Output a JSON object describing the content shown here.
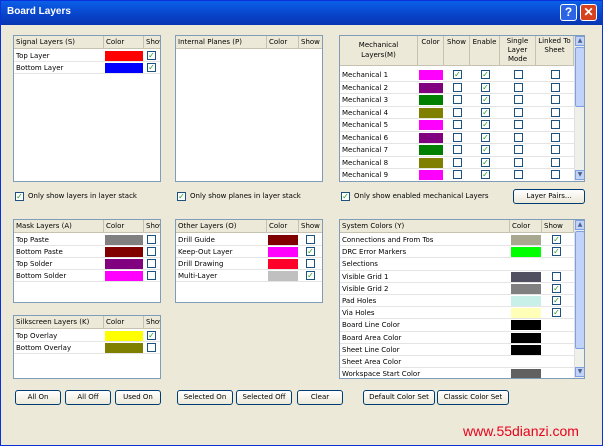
{
  "window": {
    "title": "Board Layers",
    "help_label": "?",
    "close_label": "✕"
  },
  "signal": {
    "headers": {
      "name": "Signal Layers (S)",
      "color": "Color",
      "show": "Show"
    },
    "rows": [
      {
        "name": "Top Layer",
        "color": "#ff0000",
        "show": true
      },
      {
        "name": "Bottom Layer",
        "color": "#0000ff",
        "show": true
      }
    ],
    "option": "Only show layers in layer stack"
  },
  "planes": {
    "headers": {
      "name": "Internal Planes (P)",
      "color": "Color",
      "show": "Show"
    },
    "option": "Only show planes in layer stack"
  },
  "mech": {
    "headers": {
      "name": "Mechanical Layers(M)",
      "color": "Color",
      "show": "Show",
      "enable": "Enable",
      "single": "Single Layer Mode",
      "linked": "Linked To Sheet"
    },
    "rows": [
      {
        "name": "Mechanical 1",
        "color": "#ff00ff",
        "show": true,
        "enable": true
      },
      {
        "name": "Mechanical 2",
        "color": "#800080",
        "show": false,
        "enable": true
      },
      {
        "name": "Mechanical 3",
        "color": "#008000",
        "show": false,
        "enable": true
      },
      {
        "name": "Mechanical 4",
        "color": "#808000",
        "show": false,
        "enable": true
      },
      {
        "name": "Mechanical 5",
        "color": "#ff00ff",
        "show": false,
        "enable": true
      },
      {
        "name": "Mechanical 6",
        "color": "#800080",
        "show": false,
        "enable": true
      },
      {
        "name": "Mechanical 7",
        "color": "#008000",
        "show": false,
        "enable": true
      },
      {
        "name": "Mechanical 8",
        "color": "#808000",
        "show": false,
        "enable": true
      },
      {
        "name": "Mechanical 9",
        "color": "#ff00ff",
        "show": false,
        "enable": true
      }
    ],
    "option": "Only show enabled mechanical Layers",
    "layer_pairs": "Layer Pairs..."
  },
  "mask": {
    "headers": {
      "name": "Mask Layers (A)",
      "color": "Color",
      "show": "Show"
    },
    "rows": [
      {
        "name": "Top Paste",
        "color": "#808080",
        "show": false
      },
      {
        "name": "Bottom Paste",
        "color": "#800000",
        "show": false
      },
      {
        "name": "Top Solder",
        "color": "#800080",
        "show": false
      },
      {
        "name": "Bottom Solder",
        "color": "#ff00ff",
        "show": false
      }
    ]
  },
  "other": {
    "headers": {
      "name": "Other Layers (O)",
      "color": "Color",
      "show": "Show"
    },
    "rows": [
      {
        "name": "Drill Guide",
        "color": "#800000",
        "show": false
      },
      {
        "name": "Keep-Out Layer",
        "color": "#ff00ff",
        "show": true
      },
      {
        "name": "Drill Drawing",
        "color": "#ff002a",
        "show": false
      },
      {
        "name": "Multi-Layer",
        "color": "#c0c0c0",
        "show": true
      }
    ]
  },
  "silk": {
    "headers": {
      "name": "Silkscreen Layers (K)",
      "color": "Color",
      "show": "Show"
    },
    "rows": [
      {
        "name": "Top Overlay",
        "color": "#ffff00",
        "show": true
      },
      {
        "name": "Bottom Overlay",
        "color": "#808000",
        "show": false
      }
    ]
  },
  "system": {
    "headers": {
      "name": "System Colors (Y)",
      "color": "Color",
      "show": "Show"
    },
    "rows": [
      {
        "name": "Connections and From Tos",
        "color": "#a8a890",
        "show": true
      },
      {
        "name": "DRC Error Markers",
        "color": "#00ff00",
        "show": true
      },
      {
        "name": "Selections",
        "color": "#ffffff",
        "show": null
      },
      {
        "name": "Visible Grid 1",
        "color": "#505060",
        "show": false
      },
      {
        "name": "Visible Grid 2",
        "color": "#808080",
        "show": true
      },
      {
        "name": "Pad Holes",
        "color": "#c8f0e8",
        "show": true
      },
      {
        "name": "Via Holes",
        "color": "#ffffb8",
        "show": true
      },
      {
        "name": "Board Line Color",
        "color": "#000000",
        "show": null
      },
      {
        "name": "Board Area Color",
        "color": "#000000",
        "show": null
      },
      {
        "name": "Sheet Line Color",
        "color": "#000000",
        "show": null
      },
      {
        "name": "Sheet Area Color",
        "color": "#ffffff",
        "show": null
      },
      {
        "name": "Workspace Start Color",
        "color": "#606060",
        "show": null
      }
    ]
  },
  "buttons": {
    "all_on": "All On",
    "all_off": "All Off",
    "used_on": "Used On",
    "selected_on": "Selected On",
    "selected_off": "Selected Off",
    "clear": "Clear",
    "default_color": "Default Color Set",
    "classic_color": "Classic Color Set"
  },
  "watermark": "www.55dianzi.com"
}
